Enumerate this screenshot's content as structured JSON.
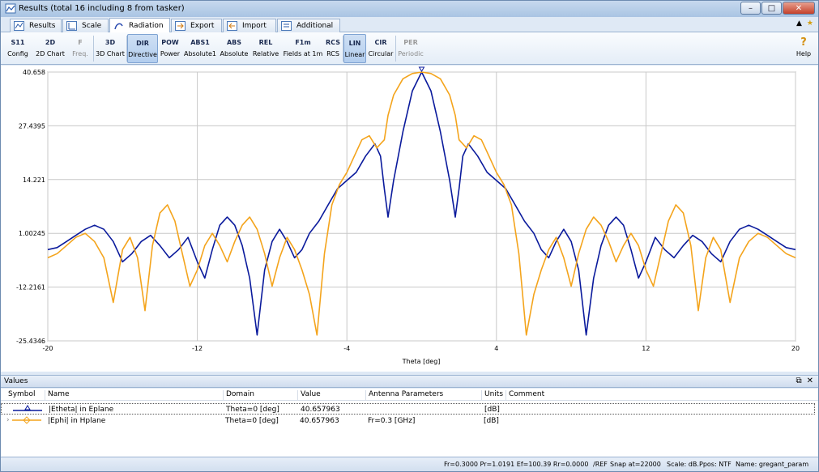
{
  "window": {
    "title": "Results (total 16 including 8 from tasker)",
    "controls": [
      "minimize-icon",
      "maximize-icon",
      "close-icon"
    ]
  },
  "tabs": [
    {
      "label": "Results",
      "icon": "results-icon"
    },
    {
      "label": "Scale",
      "icon": "scale-icon"
    },
    {
      "label": "Radiation",
      "icon": "radiation-icon",
      "active": true
    },
    {
      "label": "Export",
      "icon": "export-icon"
    },
    {
      "label": "Import",
      "icon": "import-icon"
    },
    {
      "label": "Additional",
      "icon": "additional-icon"
    }
  ],
  "ribbon": [
    {
      "label": "Config",
      "glyph": "S11"
    },
    {
      "label": "2D Chart",
      "glyph": "2D"
    },
    {
      "label": "Freq.",
      "glyph": "F",
      "disabled": true
    },
    {
      "label": "3D Chart",
      "glyph": "3D"
    },
    {
      "label": "Directive",
      "glyph": "DIR",
      "active": true
    },
    {
      "label": "Power",
      "glyph": "POW"
    },
    {
      "label": "Absolute1",
      "glyph": "ABS1"
    },
    {
      "label": "Absolute",
      "glyph": "ABS"
    },
    {
      "label": "Relative",
      "glyph": "REL"
    },
    {
      "label": "Fields at 1m",
      "glyph": "F1m"
    },
    {
      "label": "RCS",
      "glyph": "RCS"
    },
    {
      "label": "Linear",
      "glyph": "LIN",
      "active": true
    },
    {
      "label": "Circular",
      "glyph": "CIR"
    },
    {
      "label": "Periodic",
      "glyph": "PER",
      "disabled": true
    },
    {
      "label": "Help",
      "glyph": "?"
    }
  ],
  "chart_data": {
    "type": "line",
    "xlabel": "Theta [deg]",
    "xlim": [
      -20,
      20
    ],
    "ylim": [
      -25.4346,
      40.658
    ],
    "x_ticks": [
      -20,
      -12,
      -4,
      4,
      12,
      20
    ],
    "y_ticks": [
      "40.658",
      "27.4395",
      "14.221",
      "1.00245",
      "-12.2161",
      "-25.4346"
    ],
    "y_tick_values": [
      40.658,
      27.4395,
      14.221,
      1.00245,
      -12.2161,
      -25.4346
    ],
    "grid": true,
    "series": [
      {
        "name": "|Etheta| in Eplane",
        "color": "#0a1a9c",
        "x": [
          -20,
          -19.5,
          -19,
          -18.5,
          -18,
          -17.5,
          -17,
          -16.5,
          -16,
          -15.5,
          -15,
          -14.5,
          -14,
          -13.5,
          -13,
          -12.5,
          -12,
          -11.6,
          -11.2,
          -10.8,
          -10.4,
          -10,
          -9.6,
          -9.2,
          -8.8,
          -8.4,
          -8,
          -7.6,
          -7.2,
          -6.8,
          -6.4,
          -6,
          -5.5,
          -5,
          -4.5,
          -4,
          -3.5,
          -3,
          -2.5,
          -2.2,
          -2,
          -1.8,
          -1.5,
          -1,
          -0.5,
          0,
          0.5,
          1,
          1.5,
          1.8,
          2,
          2.2,
          2.5,
          3,
          3.5,
          4,
          4.5,
          5,
          5.5,
          6,
          6.4,
          6.8,
          7.2,
          7.6,
          8,
          8.4,
          8.8,
          9.2,
          9.6,
          10,
          10.4,
          10.8,
          11.2,
          11.6,
          12,
          12.5,
          13,
          13.5,
          14,
          14.5,
          15,
          15.5,
          16,
          16.5,
          17,
          17.5,
          18,
          18.5,
          19,
          19.5,
          20
        ],
        "y": [
          -3,
          -2.5,
          -1,
          0.5,
          2,
          3,
          2,
          -1,
          -6,
          -4,
          -1,
          0.5,
          -2,
          -5,
          -3,
          0,
          -6,
          -10,
          -3,
          3,
          5,
          3,
          -2,
          -10,
          -24,
          -8,
          -1,
          2,
          -1,
          -5,
          -3,
          1,
          4,
          8,
          12,
          14,
          16,
          20,
          23,
          20,
          12,
          5,
          14,
          26,
          36,
          40.658,
          36,
          26,
          14,
          5,
          12,
          20,
          23,
          20,
          16,
          14,
          12,
          8,
          4,
          1,
          -3,
          -5,
          -1,
          2,
          -1,
          -8,
          -24,
          -10,
          -2,
          3,
          5,
          3,
          -3,
          -10,
          -6,
          0,
          -3,
          -5,
          -2,
          0.5,
          -1,
          -4,
          -6,
          -1,
          2,
          3,
          2,
          0.5,
          -1,
          -2.5,
          -3
        ]
      },
      {
        "name": "|Ephi| in Hplane",
        "color": "#f4a41c",
        "x": [
          -20,
          -19.5,
          -19,
          -18.5,
          -18,
          -17.5,
          -17,
          -16.5,
          -16,
          -15.6,
          -15.2,
          -14.8,
          -14.4,
          -14,
          -13.6,
          -13.2,
          -12.8,
          -12.4,
          -12,
          -11.6,
          -11.2,
          -10.8,
          -10.4,
          -10,
          -9.6,
          -9.2,
          -8.8,
          -8.4,
          -8,
          -7.6,
          -7.2,
          -6.8,
          -6.4,
          -6,
          -5.6,
          -5.2,
          -4.8,
          -4.4,
          -4,
          -3.6,
          -3.2,
          -2.8,
          -2.4,
          -2,
          -1.8,
          -1.5,
          -1,
          -0.5,
          0,
          0.5,
          1,
          1.5,
          1.8,
          2,
          2.4,
          2.8,
          3.2,
          3.6,
          4,
          4.4,
          4.8,
          5.2,
          5.6,
          6,
          6.4,
          6.8,
          7.2,
          7.6,
          8,
          8.4,
          8.8,
          9.2,
          9.6,
          10,
          10.4,
          10.8,
          11.2,
          11.6,
          12,
          12.4,
          12.8,
          13.2,
          13.6,
          14,
          14.4,
          14.8,
          15.2,
          15.6,
          16,
          16.5,
          17,
          17.5,
          18,
          18.5,
          19,
          19.5,
          20
        ],
        "y": [
          -5,
          -4,
          -2,
          0,
          1,
          -1,
          -5,
          -16,
          -3,
          0,
          -5,
          -18,
          -2,
          6,
          8,
          4,
          -4,
          -12,
          -8,
          -2,
          1,
          -2,
          -6,
          -1,
          3,
          5,
          2,
          -4,
          -12,
          -5,
          0,
          -3,
          -8,
          -14,
          -24,
          -4,
          8,
          13,
          16,
          20,
          24,
          25,
          22,
          24,
          30,
          35,
          39,
          40.3,
          40.658,
          40.3,
          39,
          35,
          30,
          24,
          22,
          25,
          24,
          20,
          16,
          13,
          8,
          -4,
          -24,
          -14,
          -8,
          -3,
          0,
          -5,
          -12,
          -4,
          2,
          5,
          3,
          -1,
          -6,
          -2,
          1,
          -2,
          -8,
          -12,
          -4,
          4,
          8,
          6,
          -2,
          -18,
          -5,
          0,
          -3,
          -16,
          -5,
          -1,
          1,
          0,
          -2,
          -4,
          -5
        ]
      }
    ]
  },
  "values_panel": {
    "title": "Values",
    "columns": [
      "Symbol",
      "Name",
      "Domain",
      "Value",
      "Antenna Parameters",
      "Units",
      "Comment"
    ],
    "rows": [
      {
        "name": "|Etheta| in Eplane",
        "domain": "Theta=0 [deg]",
        "value": "40.657963",
        "params": "",
        "units": "[dB]",
        "comment": "",
        "color": "#0a1a9c"
      },
      {
        "name": "|Ephi| in Hplane",
        "domain": "Theta=0 [deg]",
        "value": "40.657963",
        "params": "Fr=0.3 [GHz]",
        "units": "[dB]",
        "comment": "",
        "color": "#f4a41c"
      }
    ]
  },
  "status": {
    "freq": "Fr=0.3000 Pr=1.0191 Ef=100.39 Rr=0.0000",
    "ref": "/REF",
    "snap": "Snap at=22000",
    "scale": "Scale: dB.",
    "ppos": "Ppos: NTF",
    "name": "Name: gregant_param"
  }
}
